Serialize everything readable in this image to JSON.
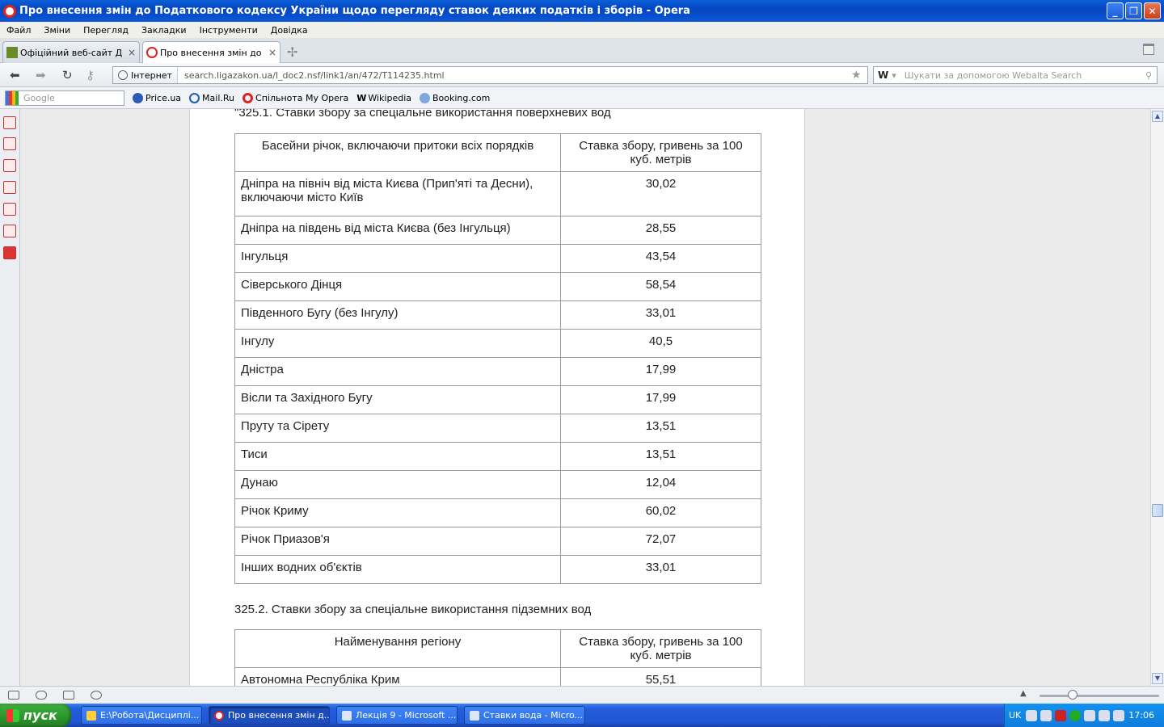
{
  "window": {
    "title": "Про внесення змін до Податкового кодексу України щодо перегляду ставок деяких податків і зборів - Opera"
  },
  "menu": [
    "Файл",
    "Зміни",
    "Перегляд",
    "Закладки",
    "Інструменти",
    "Довідка"
  ],
  "tabs": [
    {
      "label": "Офіційний веб-сайт Де...",
      "close": "×"
    },
    {
      "label": "Про внесення змін до П...",
      "close": "×"
    }
  ],
  "address": {
    "badge": "Інтернет",
    "url": "search.ligazakon.ua/l_doc2.nsf/link1/an/472/T114235.html"
  },
  "search": {
    "engine_label": "W",
    "placeholder": "Шукати за допомогою Webalta Search"
  },
  "bookmarks": {
    "google_placeholder": "Google",
    "items": [
      "Price.ua",
      "Mail.Ru",
      "Спільнота My Opera",
      "Wikipedia",
      "Booking.com"
    ]
  },
  "doc": {
    "heading1": "\"325.1. Ставки збору за спеціальне використання поверхневих вод",
    "table1": {
      "headers": [
        "Басейни річок, включаючи притоки всіх порядків",
        "Ставка збору, гривень за 100 куб. метрів"
      ],
      "rows": [
        [
          "Дніпра на північ від міста Києва (Прип'яті та Десни), включаючи місто Київ",
          "30,02"
        ],
        [
          "Дніпра на південь від міста Києва (без Інгульця)",
          "28,55"
        ],
        [
          "Інгульця",
          "43,54"
        ],
        [
          "Сіверського Дінця",
          "58,54"
        ],
        [
          "Південного Бугу (без Інгулу)",
          "33,01"
        ],
        [
          "Інгулу",
          "40,5"
        ],
        [
          "Дністра",
          "17,99"
        ],
        [
          "Вісли та Західного Бугу",
          "17,99"
        ],
        [
          "Пруту та Сірету",
          "13,51"
        ],
        [
          "Тиси",
          "13,51"
        ],
        [
          "Дунаю",
          "12,04"
        ],
        [
          "Річок Криму",
          "60,02"
        ],
        [
          "Річок Приазов'я",
          "72,07"
        ],
        [
          "Інших водних об'єктів",
          "33,01"
        ]
      ]
    },
    "heading2": "325.2. Ставки збору за спеціальне використання підземних вод",
    "table2": {
      "headers": [
        "Найменування регіону",
        "Ставка збору, гривень за 100 куб. метрів"
      ],
      "partial_row": [
        "Автономна Республіка Крим",
        "55,51"
      ]
    }
  },
  "taskbar": {
    "start": "пуск",
    "tasks": [
      "E:\\Робота\\Дисциплі...",
      "Про внесення змін д...",
      "Лекція 9 - Microsoft ...",
      "Ставки вода - Micro..."
    ],
    "lang": "UK",
    "clock": "17:06"
  }
}
